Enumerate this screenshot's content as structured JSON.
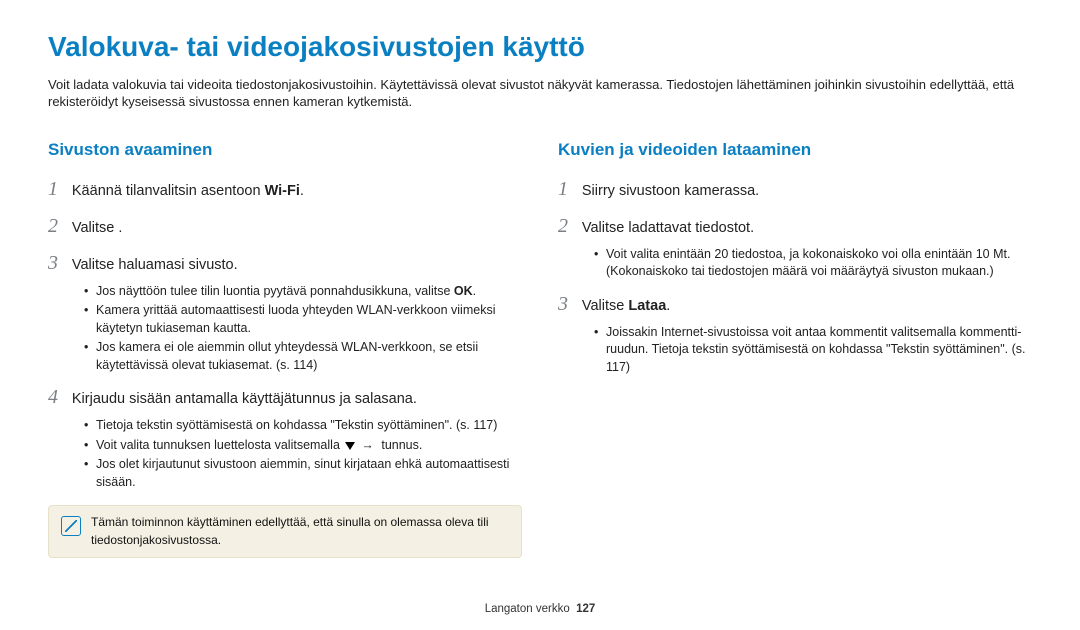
{
  "title": "Valokuva- tai videojakosivustojen käyttö",
  "intro": "Voit ladata valokuvia tai videoita tiedostonjakosivustoihin. Käytettävissä olevat sivustot näkyvät kamerassa. Tiedostojen lähettäminen joihinkin sivustoihin edellyttää, että rekisteröidyt kyseisessä sivustossa ennen kameran kytkemistä.",
  "left": {
    "heading": "Sivuston avaaminen",
    "steps": {
      "s1": {
        "num": "1",
        "pre": "Käännä tilanvalitsin asentoon ",
        "wifi": "Wi-Fi",
        "post": "."
      },
      "s2": {
        "num": "2",
        "text": "Valitse        ."
      },
      "s3": {
        "num": "3",
        "text": "Valitse haluamasi sivusto.",
        "bullets": [
          "Jos näyttöön tulee tilin luontia pyytävä ponnahdusikkuna, valitse ",
          "Kamera yrittää automaattisesti luoda yhteyden WLAN-verkkoon viimeksi käytetyn tukiaseman kautta.",
          "Jos kamera ei ole aiemmin ollut yhteydessä WLAN-verkkoon, se etsii käytettävissä olevat tukiasemat. (s. 114)"
        ],
        "ok": "OK"
      },
      "s4": {
        "num": "4",
        "text": "Kirjaudu sisään antamalla käyttäjätunnus ja salasana.",
        "bullets": [
          "Tietoja tekstin syöttämisestä on kohdassa \"Tekstin syöttäminen\". (s. 117)",
          {
            "pre": "Voit valita tunnuksen luettelosta valitsemalla ",
            "post": " tunnus."
          },
          "Jos olet kirjautunut sivustoon aiemmin, sinut kirjataan ehkä automaattisesti sisään."
        ]
      }
    },
    "note": "Tämän toiminnon käyttäminen edellyttää, että sinulla on olemassa oleva tili tiedostonjakosivustossa."
  },
  "right": {
    "heading": "Kuvien ja videoiden lataaminen",
    "steps": {
      "s1": {
        "num": "1",
        "text": "Siirry sivustoon kamerassa."
      },
      "s2": {
        "num": "2",
        "text": "Valitse ladattavat tiedostot.",
        "bullets": [
          "Voit valita enintään 20 tiedostoa, ja kokonaiskoko voi olla enintään 10 Mt. (Kokonaiskoko tai tiedostojen määrä voi määräytyä sivuston mukaan.)"
        ]
      },
      "s3": {
        "num": "3",
        "pre": "Valitse ",
        "bold": "Lataa",
        "post": ".",
        "bullets": [
          "Joissakin Internet-sivustoissa voit antaa kommentit valitsemalla kommentti-ruudun. Tietoja tekstin syöttämisestä on kohdassa \"Tekstin syöttäminen\". (s. 117)"
        ]
      }
    }
  },
  "footer": {
    "section": "Langaton verkko",
    "page": "127"
  }
}
